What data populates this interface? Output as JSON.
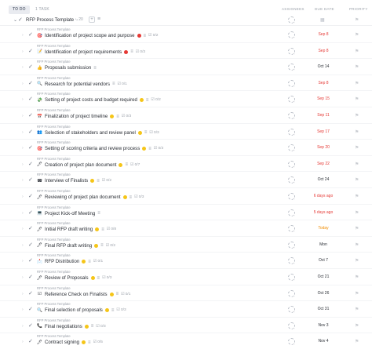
{
  "header": {
    "status": "TO DO",
    "task_count": "1 TASK",
    "col_assignees": "ASSIGNEES",
    "col_due": "DUE DATE",
    "col_priority": "PRIORITY"
  },
  "parent": {
    "title": "RFP Process Template",
    "subtask_count": "20",
    "plus": "+"
  },
  "colors": {
    "overdue": "#e53935",
    "today": "#f08c00",
    "dot_red": "#e53935",
    "dot_yellow": "#f5c518"
  },
  "rows": [
    {
      "crumb": "RFP Process Template",
      "emoji": "🎯",
      "name": "Identification of project scope and purpose",
      "dot": "red",
      "lines": true,
      "checklist": "0/2",
      "due": "Sep 8",
      "due_state": "overdue"
    },
    {
      "crumb": "RFP Process Template",
      "emoji": "📝",
      "name": "Identification of project requirements",
      "dot": "red",
      "lines": true,
      "checklist": "0/3",
      "due": "Sep 8",
      "due_state": "overdue"
    },
    {
      "crumb": "RFP Process Template",
      "emoji": "👍",
      "name": "Proposals submission",
      "dot": "",
      "lines": true,
      "checklist": "",
      "due": "Oct 14",
      "due_state": "normal"
    },
    {
      "crumb": "RFP Process Template",
      "emoji": "🔍",
      "name": "Research for potential vendors",
      "dot": "",
      "lines": true,
      "checklist": "0/1",
      "due": "Sep 8",
      "due_state": "overdue"
    },
    {
      "crumb": "RFP Process Template",
      "emoji": "💸",
      "name": "Setting of project costs and budget required",
      "dot": "yellow",
      "lines": true,
      "checklist": "0/2",
      "due": "Sep 15",
      "due_state": "overdue"
    },
    {
      "crumb": "RFP Process Template",
      "emoji": "📅",
      "name": "Finalization of project timeline",
      "dot": "yellow",
      "lines": true,
      "checklist": "0/3",
      "due": "Sep 11",
      "due_state": "overdue"
    },
    {
      "crumb": "RFP Process Template",
      "emoji": "👥",
      "name": "Selection of stakeholders and review panel",
      "dot": "yellow",
      "lines": true,
      "checklist": "0/3",
      "due": "Sep 17",
      "due_state": "overdue"
    },
    {
      "crumb": "RFP Process Template",
      "emoji": "🎯",
      "name": "Setting of scoring criteria and review process",
      "dot": "yellow",
      "lines": true,
      "checklist": "0/3",
      "due": "Sep 20",
      "due_state": "overdue"
    },
    {
      "crumb": "RFP Process Template",
      "emoji": "🖋",
      "name": "Creation of project plan document",
      "dot": "yellow",
      "lines": true,
      "checklist": "0/7",
      "due": "Sep 22",
      "due_state": "overdue"
    },
    {
      "crumb": "RFP Process Template",
      "emoji": "☎",
      "name": "Interview of Finalists",
      "dot": "yellow",
      "lines": true,
      "checklist": "0/2",
      "due": "Oct 24",
      "due_state": "normal"
    },
    {
      "crumb": "RFP Process Template",
      "emoji": "🖋",
      "name": "Reviewing of project plan document",
      "dot": "yellow",
      "lines": true,
      "checklist": "0/3",
      "due": "6 days ago",
      "due_state": "overdue"
    },
    {
      "crumb": "RFP Process Template",
      "emoji": "💻",
      "name": "Project Kick-off Meeting",
      "dot": "",
      "lines": true,
      "checklist": "",
      "due": "5 days ago",
      "due_state": "overdue"
    },
    {
      "crumb": "RFP Process Template",
      "emoji": "🖋",
      "name": "Initial RFP draft writing",
      "dot": "yellow",
      "lines": true,
      "checklist": "0/8",
      "due": "Today",
      "due_state": "today"
    },
    {
      "crumb": "RFP Process Template",
      "emoji": "🖋",
      "name": "Final RFP draft writing",
      "dot": "yellow",
      "lines": true,
      "checklist": "0/2",
      "due": "Mon",
      "due_state": "normal"
    },
    {
      "crumb": "RFP Process Template",
      "emoji": "📩",
      "name": "RFP Distribution",
      "dot": "yellow",
      "lines": true,
      "checklist": "0/1",
      "due": "Oct 7",
      "due_state": "normal"
    },
    {
      "crumb": "RFP Process Template",
      "emoji": "🖋",
      "name": "Review of Proposals",
      "dot": "yellow",
      "lines": true,
      "checklist": "0/3",
      "due": "Oct 21",
      "due_state": "normal"
    },
    {
      "crumb": "RFP Process Template",
      "emoji": "☑",
      "name": "Reference Check on Finalists",
      "dot": "yellow",
      "lines": true,
      "checklist": "0/1",
      "due": "Oct 26",
      "due_state": "normal"
    },
    {
      "crumb": "RFP Process Template",
      "emoji": "🔍",
      "name": "Final selection of proposals",
      "dot": "yellow",
      "lines": true,
      "checklist": "0/3",
      "due": "Oct 31",
      "due_state": "normal"
    },
    {
      "crumb": "RFP Process Template",
      "emoji": "📞",
      "name": "Final negotiations",
      "dot": "yellow",
      "lines": true,
      "checklist": "0/3",
      "due": "Nov 3",
      "due_state": "normal"
    },
    {
      "crumb": "RFP Process Template",
      "emoji": "🖋",
      "name": "Contract signing",
      "dot": "yellow",
      "lines": true,
      "checklist": "0/5",
      "due": "Nov 4",
      "due_state": "normal"
    }
  ]
}
